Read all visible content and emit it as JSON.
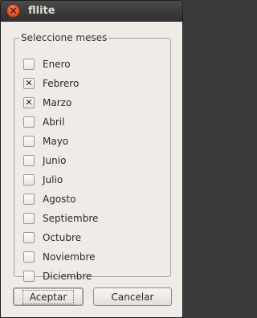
{
  "window": {
    "title": "fllite",
    "close_glyph": "×"
  },
  "group": {
    "legend": "Seleccione meses"
  },
  "months": [
    {
      "label": "Enero",
      "checked": false
    },
    {
      "label": "Febrero",
      "checked": true
    },
    {
      "label": "Marzo",
      "checked": true
    },
    {
      "label": "Abril",
      "checked": false
    },
    {
      "label": "Mayo",
      "checked": false
    },
    {
      "label": "Junio",
      "checked": false
    },
    {
      "label": "Julio",
      "checked": false
    },
    {
      "label": "Agosto",
      "checked": false
    },
    {
      "label": "Septiembre",
      "checked": false
    },
    {
      "label": "Octubre",
      "checked": false
    },
    {
      "label": "Noviembre",
      "checked": false
    },
    {
      "label": "Diciembre",
      "checked": false
    }
  ],
  "check_mark": "✕",
  "buttons": {
    "accept": "Aceptar",
    "cancel": "Cancelar"
  },
  "colors": {
    "titlebar": "#3c3c3c",
    "close": "#e2562c",
    "dialog_bg": "#efebe7"
  }
}
